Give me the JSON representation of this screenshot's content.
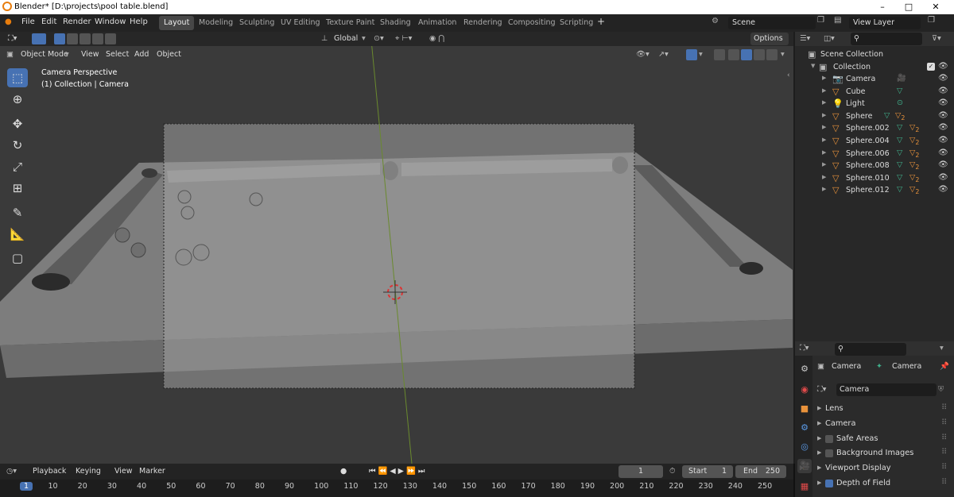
{
  "window": {
    "title": "Blender* [D:\\projects\\pool table.blend]",
    "minimize": "–",
    "maximize": "□",
    "close": "✕"
  },
  "menubar": {
    "menus": [
      "File",
      "Edit",
      "Render",
      "Window",
      "Help"
    ],
    "workspaces": [
      "Layout",
      "Modeling",
      "Sculpting",
      "UV Editing",
      "Texture Paint",
      "Shading",
      "Animation",
      "Rendering",
      "Compositing",
      "Scripting"
    ],
    "add_workspace": "+",
    "scene": "Scene",
    "view_layer": "View Layer"
  },
  "viewport_header": {
    "transform_orientation": "Global",
    "options": "Options",
    "mode": "Object Mode",
    "menus": [
      "View",
      "Select",
      "Add",
      "Object"
    ]
  },
  "viewport": {
    "camera_line1": "Camera Perspective",
    "camera_line2": "(1) Collection | Camera"
  },
  "outliner": {
    "scene_collection": "Scene Collection",
    "collection": "Collection",
    "items": [
      {
        "name": "Camera",
        "icon": "camera-icon"
      },
      {
        "name": "Cube",
        "icon": "mesh-icon"
      },
      {
        "name": "Light",
        "icon": "light-icon"
      },
      {
        "name": "Sphere",
        "icon": "mesh-icon"
      },
      {
        "name": "Sphere.002",
        "icon": "mesh-icon"
      },
      {
        "name": "Sphere.004",
        "icon": "mesh-icon"
      },
      {
        "name": "Sphere.006",
        "icon": "mesh-icon"
      },
      {
        "name": "Sphere.008",
        "icon": "mesh-icon"
      },
      {
        "name": "Sphere.010",
        "icon": "mesh-icon"
      },
      {
        "name": "Sphere.012",
        "icon": "mesh-icon"
      }
    ],
    "modifier_count": "2"
  },
  "properties": {
    "object_name": "Camera",
    "data_name": "Camera",
    "datablock": "Camera",
    "panels": [
      {
        "label": "Lens",
        "checkbox": null
      },
      {
        "label": "Camera",
        "checkbox": null
      },
      {
        "label": "Safe Areas",
        "checkbox": false
      },
      {
        "label": "Background Images",
        "checkbox": false
      },
      {
        "label": "Viewport Display",
        "checkbox": null
      },
      {
        "label": "Depth of Field",
        "checkbox": true
      }
    ]
  },
  "timeline": {
    "menus": [
      "Playback",
      "Keying",
      "View",
      "Marker"
    ],
    "current_frame": "1",
    "start_label": "Start",
    "start": "1",
    "end_label": "End",
    "end": "250",
    "ruler": [
      "1",
      "10",
      "20",
      "30",
      "40",
      "50",
      "60",
      "70",
      "80",
      "90",
      "100",
      "110",
      "120",
      "130",
      "140",
      "150",
      "160",
      "170",
      "180",
      "190",
      "200",
      "210",
      "220",
      "230",
      "240",
      "250"
    ]
  },
  "colors": {
    "accent": "#4772b3",
    "orange": "#e8923b",
    "green": "#3fae8a"
  }
}
